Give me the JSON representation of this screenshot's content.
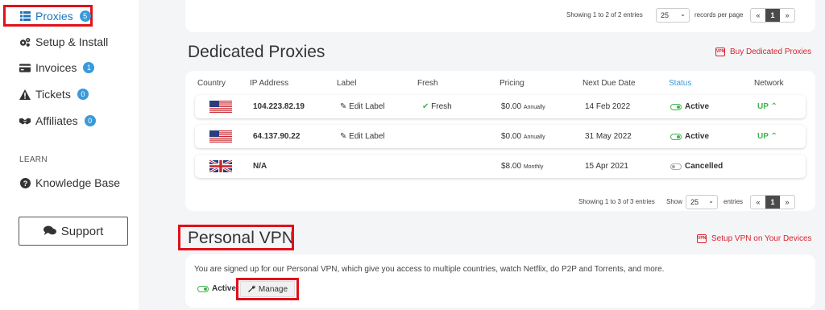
{
  "sidebar": {
    "items": [
      {
        "label": "Proxies",
        "badge": "5",
        "icon": "list-icon"
      },
      {
        "label": "Setup & Install",
        "icon": "gears-icon"
      },
      {
        "label": "Invoices",
        "badge": "1",
        "icon": "credit-card-icon"
      },
      {
        "label": "Tickets",
        "badge": "0",
        "icon": "warning-icon"
      },
      {
        "label": "Affiliates",
        "badge": "0",
        "icon": "handshake-icon"
      }
    ],
    "learn_heading": "LEARN",
    "knowledge_base": "Knowledge Base",
    "support_label": "Support"
  },
  "top_pagination": {
    "showing": "Showing 1 to 2 of 2 entries",
    "per_page_value": "25",
    "per_page_suffix": "records per page",
    "prev": "«",
    "page": "1",
    "next": "»"
  },
  "dedicated": {
    "title": "Dedicated Proxies",
    "buy_link": "Buy Dedicated Proxies",
    "columns": [
      "Country",
      "IP Address",
      "Label",
      "Fresh",
      "Pricing",
      "Next Due Date",
      "Status",
      "Network"
    ],
    "rows": [
      {
        "flag": "us",
        "ip": "104.223.82.19",
        "label": "Edit Label",
        "fresh": "Fresh",
        "price": "$0.00",
        "period": "Annually",
        "due": "14 Feb 2022",
        "status": "Active",
        "network": "UP"
      },
      {
        "flag": "us",
        "ip": "64.137.90.22",
        "label": "Edit Label",
        "fresh": "",
        "price": "$0.00",
        "period": "Annually",
        "due": "31 May 2022",
        "status": "Active",
        "network": "UP"
      },
      {
        "flag": "uk",
        "ip": "N/A",
        "label": "",
        "fresh": "",
        "price": "$8.00",
        "period": "Monthly",
        "due": "15 Apr 2021",
        "status": "Cancelled",
        "network": ""
      }
    ],
    "pagination": {
      "showing": "Showing 1 to 3 of 3 entries",
      "show_label": "Show",
      "per_page_value": "25",
      "entries_label": "entries",
      "prev": "«",
      "page": "1",
      "next": "»"
    }
  },
  "vpn": {
    "title": "Personal VPN",
    "setup_link": "Setup VPN on Your Devices",
    "description": "You are signed up for our Personal VPN, which give you access to multiple countries, watch Netflix, do P2P and Torrents, and more.",
    "status": "Active",
    "manage_label": "Manage"
  },
  "colors": {
    "accent_blue": "#3a9ad9",
    "highlight_red": "#e0111b",
    "link_red": "#d9232e",
    "success_green": "#3db54a"
  }
}
